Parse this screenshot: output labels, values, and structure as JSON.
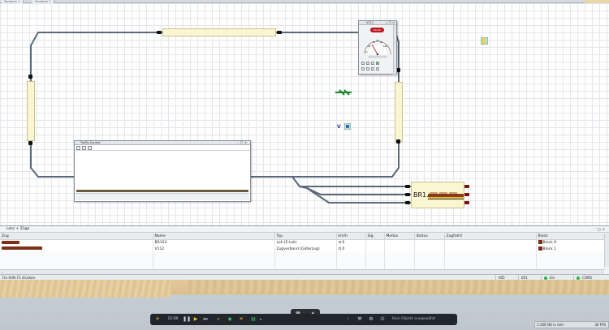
{
  "tabs": [
    {
      "label": "Stellwerk 1"
    },
    {
      "label": "Stellwerk 2"
    }
  ],
  "loco_window": {
    "title": "V112",
    "brand": "märklin",
    "speed_ticks": [
      "40",
      "60",
      "80",
      "20",
      "100",
      "0"
    ],
    "buttons": [
      "minimize",
      "maximize",
      "close"
    ]
  },
  "traffic_window": {
    "title": "Traffic-Control",
    "buttons": [
      "minimize",
      "maximize",
      "close"
    ]
  },
  "train_block": {
    "label": "BR1..."
  },
  "floating": {
    "v_label": "V"
  },
  "panel": {
    "title": "Loks + Züge",
    "columns": [
      "Zug",
      "Name",
      "Typ",
      "km/h",
      "Sig.",
      "Modus",
      "Status",
      "Zugfahrt",
      "Block"
    ],
    "rows": [
      {
        "name": "BR103",
        "typ": "Lok (E-Lok)",
        "kmh": "0",
        "block": "Block 9"
      },
      {
        "name": "V112",
        "typ": "Zugverband (Güterzug)",
        "kmh": "0",
        "block": "Block 1"
      }
    ]
  },
  "status": {
    "help": "Für Hilfe F1 drücken",
    "num1": "005",
    "num2": "001",
    "power": "Ein",
    "port": "COM3"
  },
  "toolbar": {
    "time": "12:00",
    "message": "Kein Objekt ausgewählt"
  },
  "scale": {
    "label": "1:160 (N) in mm",
    "fps": "30 FPS"
  },
  "colors": {
    "track": "#5a6878",
    "block_fill": "#fbf6d2",
    "power_on": "#27b543"
  }
}
